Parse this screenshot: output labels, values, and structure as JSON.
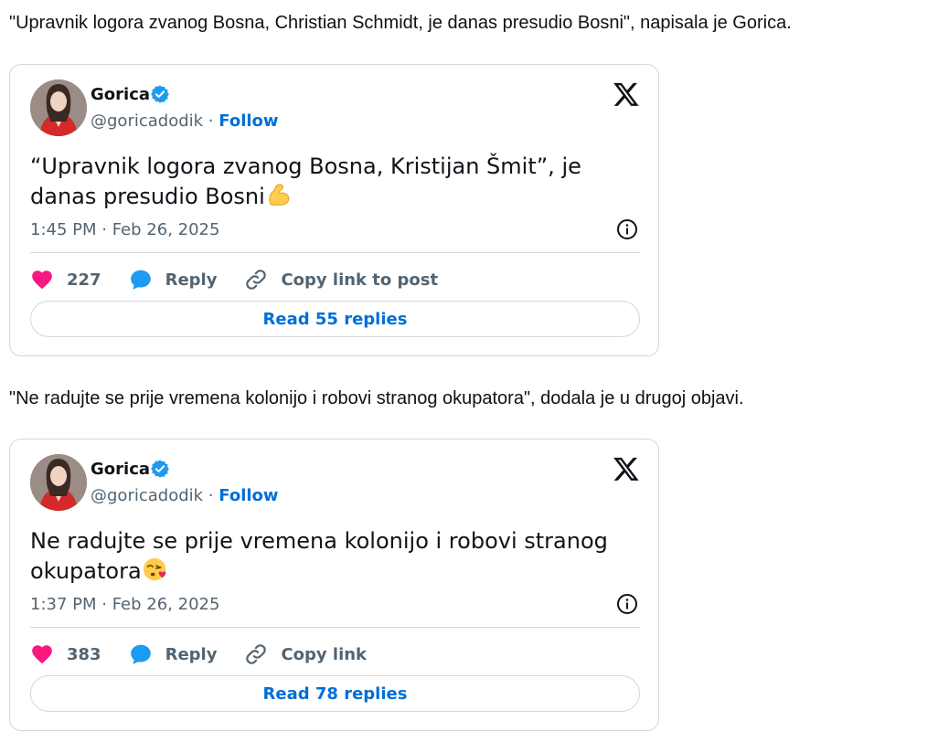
{
  "paragraphs": [
    "\"Upravnik logora zvanog Bosna, Christian Schmidt, je danas presudio Bosni\", napisala je Gorica.",
    "\"Ne radujte se prije vremena kolonijo i robovi stranog okupatora\", dodala je u drugoj objavi."
  ],
  "tweets": [
    {
      "name": "Gorica",
      "handle": "@goricadodik",
      "separator": "·",
      "follow_label": "Follow",
      "text": "“Upravnik logora zvanog Bosna, Kristijan Šmit”, je danas presudio Bosni",
      "emoji": "flexed-biceps",
      "time": "1:45 PM · Feb 26, 2025",
      "likes": "227",
      "reply_label": "Reply",
      "copy_label": "Copy link to post",
      "read_replies_label": "Read 55 replies"
    },
    {
      "name": "Gorica",
      "handle": "@goricadodik",
      "separator": "·",
      "follow_label": "Follow",
      "text": "Ne radujte se prije vremena kolonijo i robovi stranog okupatora",
      "emoji": "face-blowing-kiss",
      "time": "1:37 PM · Feb 26, 2025",
      "likes": "383",
      "reply_label": "Reply",
      "copy_label": "Copy link",
      "read_replies_label": "Read 78 replies"
    }
  ],
  "colors": {
    "link_blue": "#006fd6",
    "verified_blue": "#1d9bf0",
    "heart_pink": "#f91880",
    "reply_blue": "#1d9bf0",
    "muted": "#536471",
    "border": "#cfd9de"
  }
}
